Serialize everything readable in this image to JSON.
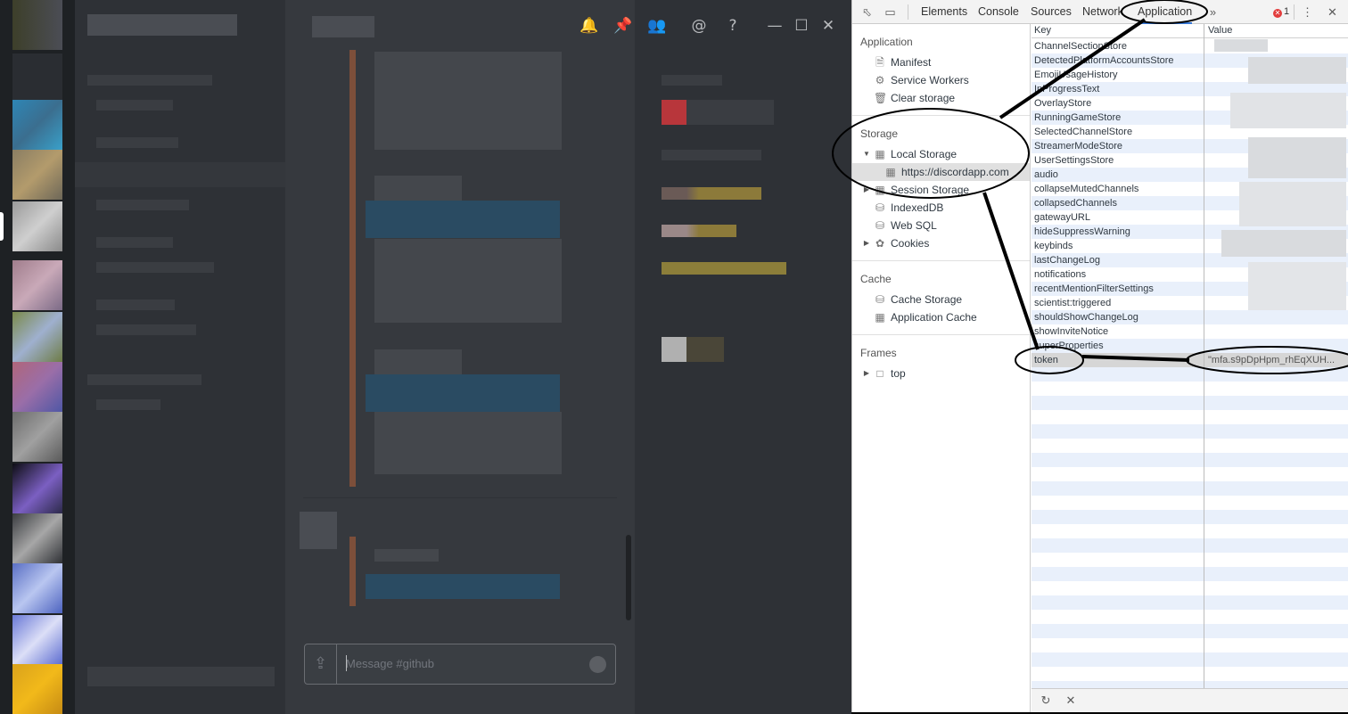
{
  "discord": {
    "composer_placeholder": "Message #github",
    "header_icons": [
      "bell-icon",
      "pin-icon",
      "members-icon",
      "mention-icon",
      "help-icon"
    ],
    "window_controls": [
      "minimize-icon",
      "maximize-icon",
      "close-icon"
    ],
    "colors": {
      "guilds": "#1e2124",
      "channels": "#2e3136",
      "chat": "#36393e",
      "accent": "#3879d9"
    }
  },
  "devtools": {
    "tabs": [
      "Elements",
      "Console",
      "Sources",
      "Network",
      "Application"
    ],
    "active_tab": "Application",
    "error_count": "1",
    "sidebar": {
      "application_header": "Application",
      "application_items": [
        "Manifest",
        "Service Workers",
        "Clear storage"
      ],
      "storage_header": "Storage",
      "local_storage": "Local Storage",
      "local_storage_origin": "https://discordapp.com",
      "session_storage": "Session Storage",
      "indexeddb": "IndexedDB",
      "websql": "Web SQL",
      "cookies": "Cookies",
      "cache_header": "Cache",
      "cache_storage": "Cache Storage",
      "application_cache": "Application Cache",
      "frames_header": "Frames",
      "frames_top": "top"
    },
    "table": {
      "key_header": "Key",
      "value_header": "Value",
      "rows": [
        {
          "key": "ChannelSectionStore",
          "value": ""
        },
        {
          "key": "DetectedPlatformAccountsStore",
          "value": ""
        },
        {
          "key": "EmojiUsageHistory",
          "value": ""
        },
        {
          "key": "InProgressText",
          "value": ""
        },
        {
          "key": "OverlayStore",
          "value": ""
        },
        {
          "key": "RunningGameStore",
          "value": ""
        },
        {
          "key": "SelectedChannelStore",
          "value": ""
        },
        {
          "key": "StreamerModeStore",
          "value": ""
        },
        {
          "key": "UserSettingsStore",
          "value": ""
        },
        {
          "key": "audio",
          "value": ""
        },
        {
          "key": "collapseMutedChannels",
          "value": ""
        },
        {
          "key": "collapsedChannels",
          "value": ""
        },
        {
          "key": "gatewayURL",
          "value": ""
        },
        {
          "key": "hideSuppressWarning",
          "value": ""
        },
        {
          "key": "keybinds",
          "value": ""
        },
        {
          "key": "lastChangeLog",
          "value": ""
        },
        {
          "key": "notifications",
          "value": ""
        },
        {
          "key": "recentMentionFilterSettings",
          "value": ""
        },
        {
          "key": "scientist:triggered",
          "value": ""
        },
        {
          "key": "shouldShowChangeLog",
          "value": ""
        },
        {
          "key": "showInviteNotice",
          "value": ""
        },
        {
          "key": "superProperties",
          "value": ""
        },
        {
          "key": "token",
          "value": "\"mfa.s9pDpHpm_rhEqXUH..."
        }
      ]
    }
  }
}
